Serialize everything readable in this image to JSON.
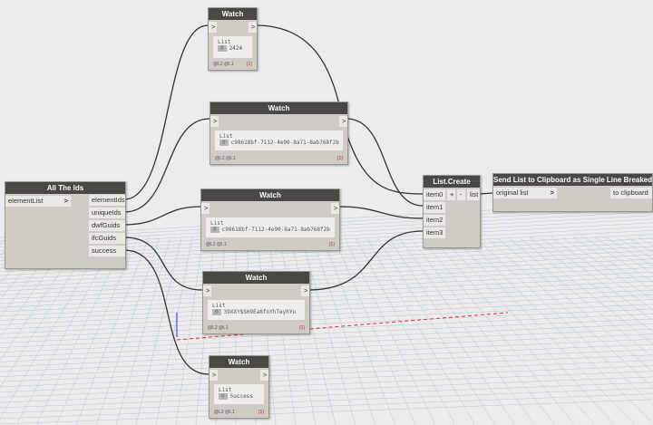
{
  "all_ids": {
    "title": "All The Ids",
    "input": "elementList",
    "outputs": [
      "elementIds",
      "uniqueIds",
      "dwfGuids",
      "ifcGuids",
      "success"
    ]
  },
  "watches": [
    {
      "title": "Watch",
      "list": "List",
      "index": "0",
      "value": "2424",
      "levels": "@L2 @L1",
      "count": "{1}"
    },
    {
      "title": "Watch",
      "list": "List",
      "index": "0",
      "value": "c98618bf-7112-4e90-8a71-8ab768f2b",
      "levels": "@L2 @L1",
      "count": "{1}"
    },
    {
      "title": "Watch",
      "list": "List",
      "index": "0",
      "value": "c98618bf-7112-4e90-8a71-8ab768f2b",
      "levels": "@L2 @L1",
      "count": "{1}"
    },
    {
      "title": "Watch",
      "list": "List",
      "index": "0",
      "value": "39XXY$SH9Ea8fnYhTeyhYu",
      "levels": "@L2 @L1",
      "count": "{1}"
    },
    {
      "title": "Watch",
      "list": "List",
      "index": "0",
      "value": "Success",
      "levels": "@L2 @L1",
      "count": "{1}"
    }
  ],
  "list_create": {
    "title": "List.Create",
    "inputs": [
      "item0",
      "item1",
      "item2",
      "item3"
    ],
    "add": "+",
    "remove": "-",
    "output": "list"
  },
  "send": {
    "title": "Send List to Clipboard as Single Line Breaked String",
    "input": "original list",
    "output": "to clipboard"
  },
  "port_glyph": ">",
  "colors": {
    "header": "#4a4845",
    "node": "#cfccc6",
    "wire": "#333333",
    "axis_red": "#e03030"
  }
}
